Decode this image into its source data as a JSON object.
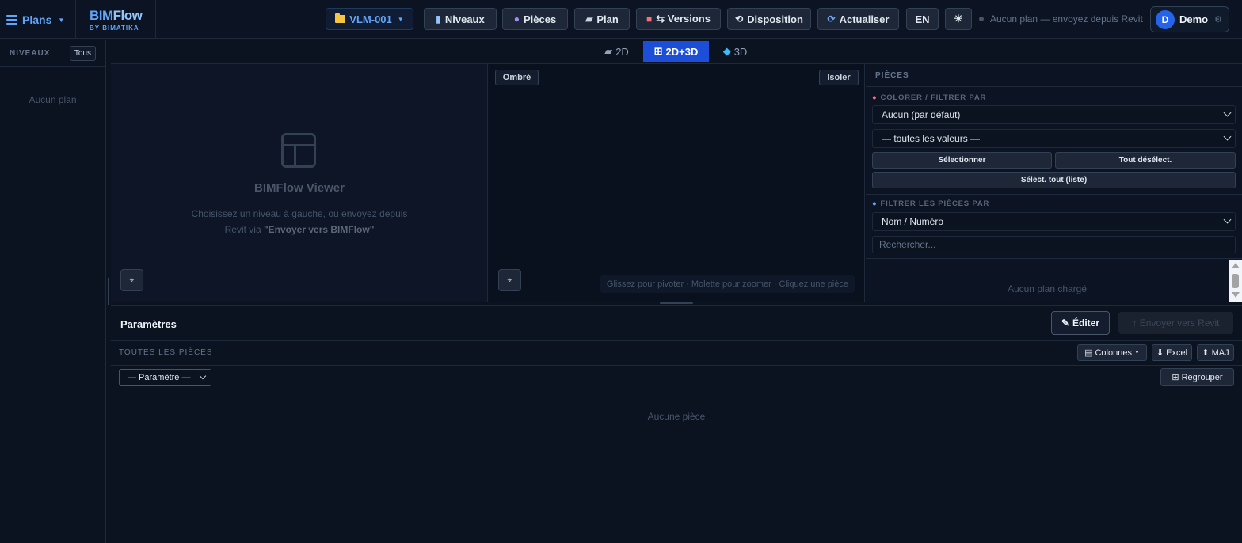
{
  "topbar": {
    "plans_label": "Plans",
    "logo_title_a": "BIM",
    "logo_title_b": "Flow",
    "logo_subtitle": "BY BIMATIKA",
    "project_label": "VLM-001",
    "buttons": {
      "niveaux": "Niveaux",
      "pieces": "Pièces",
      "plan": "Plan",
      "versions": "⇆ Versions",
      "disposition": "Disposition",
      "actualiser": "Actualiser",
      "lang": "EN",
      "theme": "☀"
    },
    "status_text": "Aucun plan — envoyez depuis Revit",
    "user": {
      "initial": "D",
      "name": "Demo",
      "gear": "⚙"
    }
  },
  "sidebar": {
    "title": "NIVEAUX",
    "all_button": "Tous",
    "empty_text": "Aucun plan"
  },
  "view_tabs": {
    "tab_2d": "2D",
    "tab_2d3d": "2D+3D",
    "tab_3d": "3D",
    "active": "2D+3D"
  },
  "viewer2d": {
    "title": "BIMFlow Viewer",
    "desc_prefix": "Choisissez un niveau à gauche, ou envoyez depuis Revit via ",
    "desc_bold": "\"Envoyer vers BIMFlow\""
  },
  "viewer3d": {
    "shade_label": "Ombré",
    "isolate_label": "Isoler",
    "hint": "Glissez pour pivoter · Molette pour zoomer · Cliquez une pièce"
  },
  "right_panel": {
    "title": "PIÈCES",
    "color_filter_title": "COLORER / FILTRER PAR",
    "color_select_value": "Aucun (par défaut)",
    "values_select_value": "— toutes les valeurs —",
    "select_btn": "Sélectionner",
    "deselect_all_btn": "Tout désélect.",
    "select_all_list_btn": "Sélect. tout (liste)",
    "filter_rooms_title": "FILTRER LES PIÈCES PAR",
    "filter_select_value": "Nom / Numéro",
    "search_placeholder": "Rechercher...",
    "empty_text": "Aucun plan chargé"
  },
  "params": {
    "title": "Paramètres",
    "edit_btn": "Éditer",
    "send_btn": "↑ Envoyer vers Revit",
    "all_rooms_label": "TOUTES LES PIÈCES",
    "columns_btn": "Colonnes",
    "excel_btn": "Excel",
    "maj_btn": "MAJ",
    "param_select_value": "— Paramètre —",
    "group_btn": "Regrouper",
    "empty_text": "Aucune pièce"
  },
  "colors": {
    "background": "#0b1220",
    "accent": "#60a5fa",
    "active_tab": "#1d4ed8"
  }
}
